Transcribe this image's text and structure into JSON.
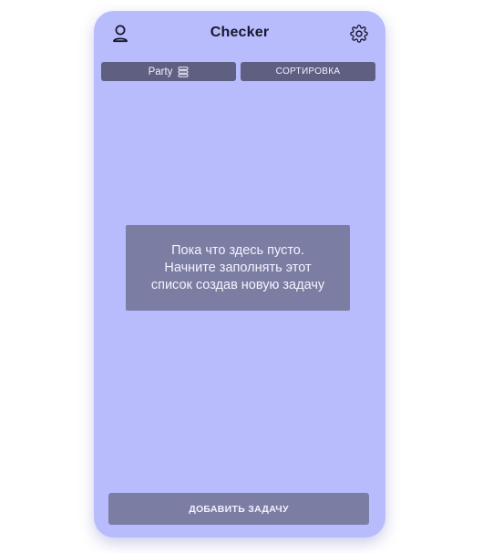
{
  "app": {
    "title": "Checker"
  },
  "header": {
    "profile_icon": "user-icon",
    "settings_icon": "gear-icon"
  },
  "tabs": [
    {
      "label": "Party",
      "icon": "list-icon"
    },
    {
      "label": "СОРТИРОВКА"
    }
  ],
  "empty_state": {
    "line1": "Пока что здесь пусто.",
    "line2": "Начните заполнять этот",
    "line3": "список создав новую задачу"
  },
  "actions": {
    "add_task_label": "ДОБАВИТЬ ЗАДАЧУ"
  },
  "colors": {
    "background": "#b8bcfd",
    "tab": "#5f5f82",
    "panel": "#7c7da3",
    "title_text": "#17172a",
    "light_text": "#f2f2ff"
  }
}
